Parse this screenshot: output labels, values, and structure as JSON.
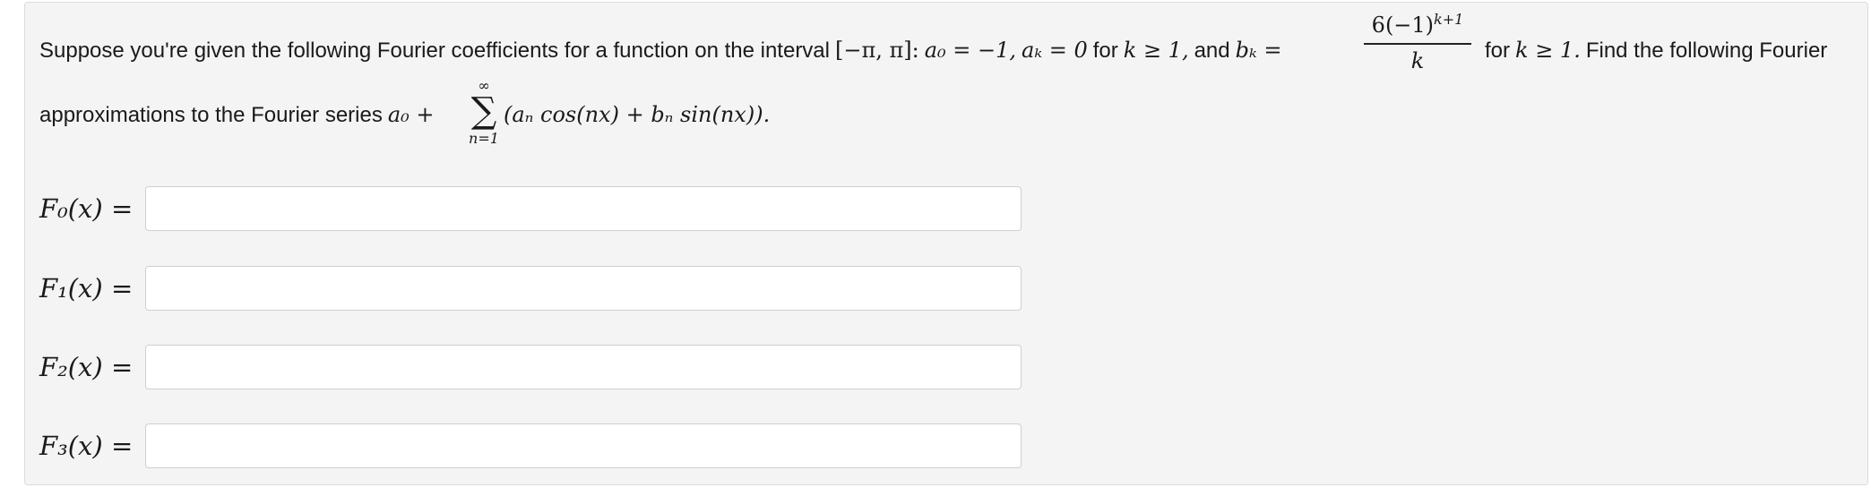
{
  "problem": {
    "intro": "Suppose you're given the following Fourier coefficients for a function on the interval",
    "interval": "[−π, π]:",
    "a0_expr": "a₀ = −1,",
    "ak_expr": "aₖ = 0",
    "for_text_1": "for",
    "k_ge_1_a": "k ≥ 1,",
    "and_text": "and",
    "bk_lhs": "bₖ =",
    "bk_numerator": "6(−1)",
    "bk_exponent": "k+1",
    "bk_denominator": "k",
    "for_text_2": "for",
    "k_ge_1_b": "k ≥ 1.",
    "tail": "Find the following Fourier",
    "line2_text": "approximations to the Fourier series",
    "series_lead": "a₀ +",
    "sum_upper": "∞",
    "sum_symbol": "∑",
    "sum_lower": "n=1",
    "series_body": "(aₙ cos(nx) + bₙ sin(nx))."
  },
  "answers": [
    {
      "label": "F₀(x) =",
      "value": "",
      "placeholder": ""
    },
    {
      "label": "F₁(x) =",
      "value": "",
      "placeholder": ""
    },
    {
      "label": "F₂(x) =",
      "value": "",
      "placeholder": ""
    },
    {
      "label": "F₃(x) =",
      "value": "",
      "placeholder": ""
    }
  ]
}
